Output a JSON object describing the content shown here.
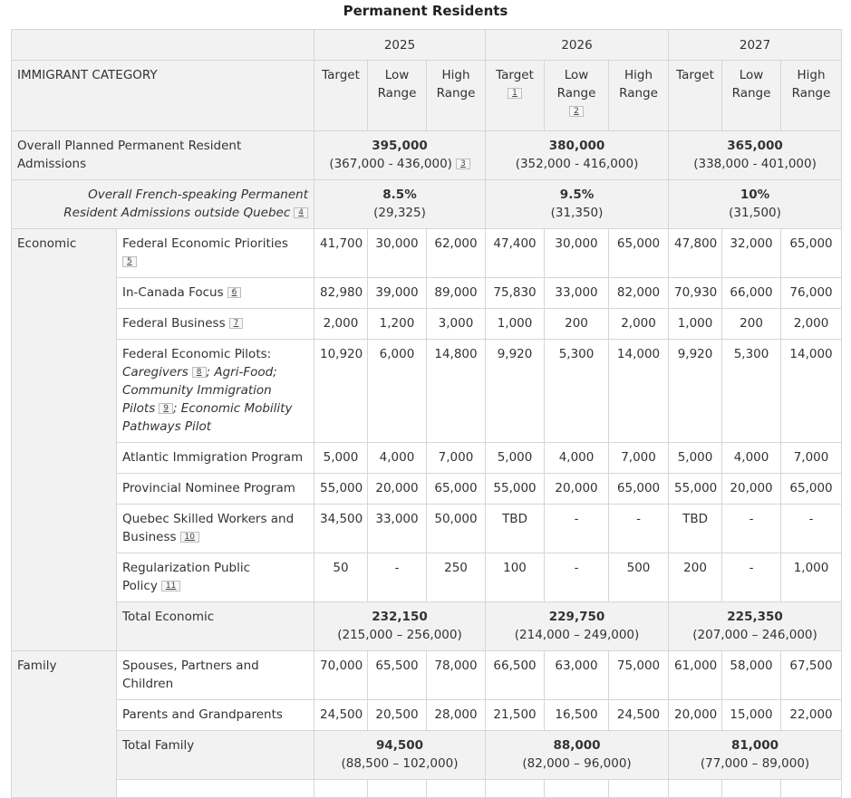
{
  "title": "Permanent Residents",
  "years": [
    "2025",
    "2026",
    "2027"
  ],
  "col_labels": {
    "category": "IMMIGRANT CATEGORY",
    "target": "Target",
    "low": "Low Range",
    "high": "High Range",
    "ref_target": "1",
    "ref_low": "2"
  },
  "overall": {
    "label": "Overall Planned Permanent Resident Admissions",
    "ref": "3",
    "years": [
      {
        "total": "395,000",
        "range": "(367,000 - 436,000)"
      },
      {
        "total": "380,000",
        "range": "(352,000 - 416,000)"
      },
      {
        "total": "365,000",
        "range": "(338,000 - 401,000)"
      }
    ]
  },
  "french": {
    "label": "Overall French-speaking Permanent Resident Admissions outside Quebec",
    "ref": "4",
    "years": [
      {
        "pct": "8.5%",
        "count": "(29,325)"
      },
      {
        "pct": "9.5%",
        "count": "(31,350)"
      },
      {
        "pct": "10%",
        "count": "(31,500)"
      }
    ]
  },
  "economic": {
    "group": "Economic",
    "rows": [
      {
        "label": "Federal Economic Priorities",
        "ref": "5",
        "values": [
          "41,700",
          "30,000",
          "62,000",
          "47,400",
          "30,000",
          "65,000",
          "47,800",
          "32,000",
          "65,000"
        ]
      },
      {
        "label": "In-Canada Focus",
        "ref": "6",
        "values": [
          "82,980",
          "39,000",
          "89,000",
          "75,830",
          "33,000",
          "82,000",
          "70,930",
          "66,000",
          "76,000"
        ]
      },
      {
        "label": "Federal Business",
        "ref": "7",
        "values": [
          "2,000",
          "1,200",
          "3,000",
          "1,000",
          "200",
          "2,000",
          "1,000",
          "200",
          "2,000"
        ]
      },
      {
        "label": "Atlantic Immigration Program",
        "values": [
          "5,000",
          "4,000",
          "7,000",
          "5,000",
          "4,000",
          "7,000",
          "5,000",
          "4,000",
          "7,000"
        ]
      },
      {
        "label": "Provincial Nominee Program",
        "values": [
          "55,000",
          "20,000",
          "65,000",
          "55,000",
          "20,000",
          "65,000",
          "55,000",
          "20,000",
          "65,000"
        ]
      },
      {
        "label": "Quebec Skilled Workers and Business",
        "ref": "10",
        "values": [
          "34,500",
          "33,000",
          "50,000",
          "TBD",
          "-",
          "-",
          "TBD",
          "-",
          "-"
        ]
      },
      {
        "label": "Regularization Public Policy",
        "ref": "11",
        "values": [
          "50",
          "-",
          "250",
          "100",
          "-",
          "500",
          "200",
          "-",
          "1,000"
        ]
      }
    ],
    "pilots": {
      "label": "Federal Economic Pilots:",
      "caregivers": "Caregivers",
      "ref_a": "8",
      "mid": "; Agri-Food; Community Immigration Pilots",
      "ref_b": "9",
      "end": "; Economic Mobility Pathways Pilot",
      "values": [
        "10,920",
        "6,000",
        "14,800",
        "9,920",
        "5,300",
        "14,000",
        "9,920",
        "5,300",
        "14,000"
      ]
    },
    "total": {
      "label": "Total Economic",
      "years": [
        {
          "total": "232,150",
          "range": "(215,000 – 256,000)"
        },
        {
          "total": "229,750",
          "range": "(214,000 – 249,000)"
        },
        {
          "total": "225,350",
          "range": "(207,000 – 246,000)"
        }
      ]
    }
  },
  "family": {
    "group": "Family",
    "rows": [
      {
        "label": "Spouses, Partners and Children",
        "values": [
          "70,000",
          "65,500",
          "78,000",
          "66,500",
          "63,000",
          "75,000",
          "61,000",
          "58,000",
          "67,500"
        ]
      },
      {
        "label": "Parents and Grandparents",
        "values": [
          "24,500",
          "20,500",
          "28,000",
          "21,500",
          "16,500",
          "24,500",
          "20,000",
          "15,000",
          "22,000"
        ]
      }
    ],
    "total": {
      "label": "Total Family",
      "years": [
        {
          "total": "94,500",
          "range": "(88,500 – 102,000)"
        },
        {
          "total": "88,000",
          "range": "(82,000 – 96,000)"
        },
        {
          "total": "81,000",
          "range": "(77,000 – 89,000)"
        }
      ]
    }
  }
}
